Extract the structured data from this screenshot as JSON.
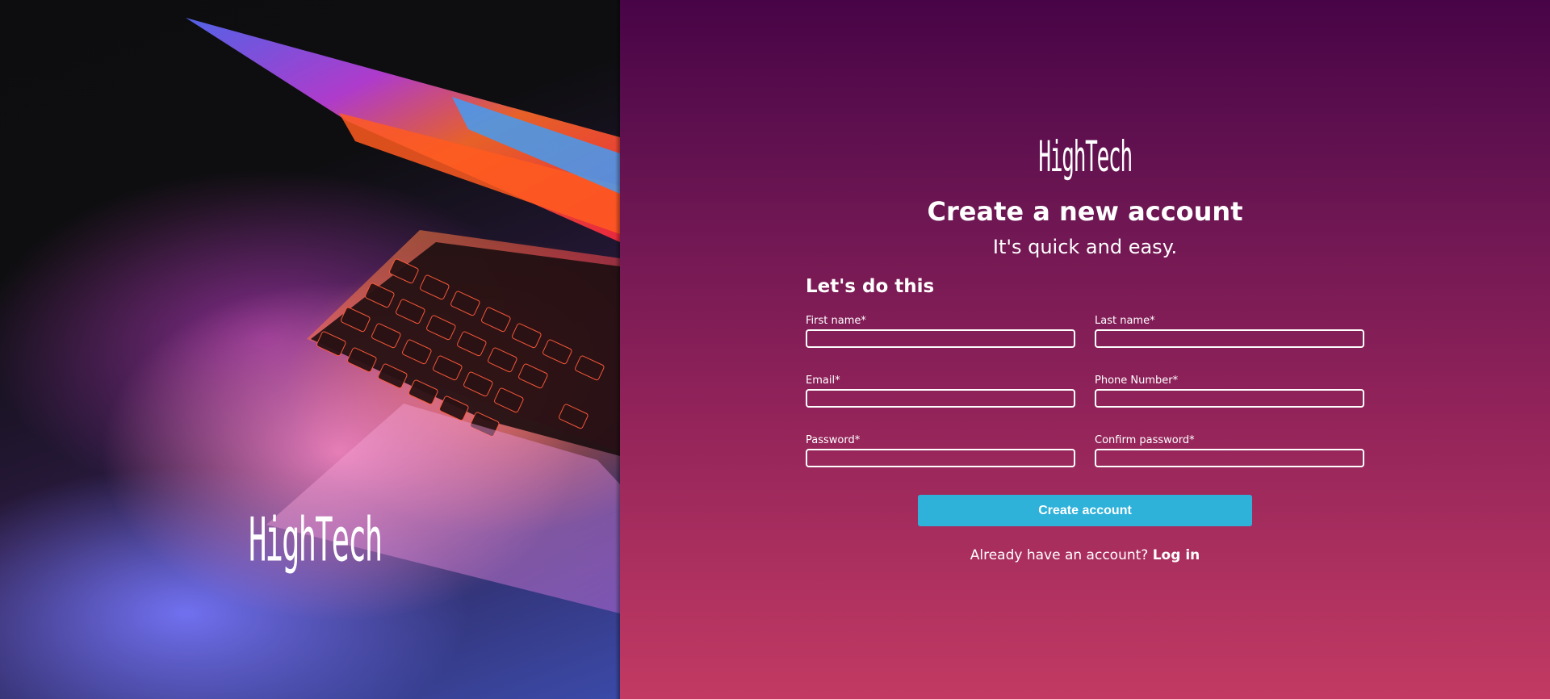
{
  "hero": {
    "logo": "HighTech"
  },
  "form": {
    "brand": "HighTech",
    "title": "Create a new account",
    "subtitle": "It's quick and easy.",
    "section_heading": "Let's do this",
    "fields": {
      "first_name": {
        "label": "First name*",
        "value": ""
      },
      "last_name": {
        "label": "Last name*",
        "value": ""
      },
      "email": {
        "label": "Email*",
        "value": ""
      },
      "phone": {
        "label": "Phone Number*",
        "value": ""
      },
      "password": {
        "label": "Password*",
        "value": ""
      },
      "confirm_password": {
        "label": "Confirm password*",
        "value": ""
      }
    },
    "submit_label": "Create account",
    "login_prompt": "Already have an account?",
    "login_link": "Log in"
  },
  "colors": {
    "button": "#2eb2da",
    "panel_top": "#470447",
    "panel_bottom": "#c23a63",
    "text": "#ffffff"
  },
  "icons": []
}
